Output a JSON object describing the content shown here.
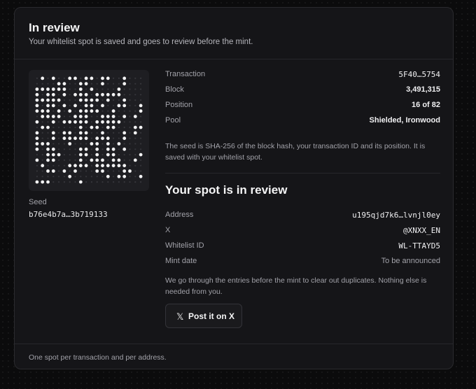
{
  "header": {
    "title": "In review",
    "subtitle": "Your whitelist spot is saved and goes to review before the mint."
  },
  "seed": {
    "label": "Seed",
    "value": "b76e4b7a…3b719133"
  },
  "details": [
    {
      "key": "Transaction",
      "value": "5F40…5754"
    },
    {
      "key": "Block",
      "value": "3,491,315"
    },
    {
      "key": "Position",
      "value": "16 of 82"
    },
    {
      "key": "Pool",
      "value": "Shielded, Ironwood"
    }
  ],
  "seed_note": "The seed is SHA-256 of the block hash, your transaction ID and its position. It is saved with your whitelist spot.",
  "review": {
    "title": "Your spot is in review",
    "rows": [
      {
        "key": "Address",
        "value": "u195qjd7k6…lvnjl0ey"
      },
      {
        "key": "X",
        "value": "@XNXX_EN"
      },
      {
        "key": "Whitelist ID",
        "value": "WL-TTAYD5"
      },
      {
        "key": "Mint date",
        "value": "To be announced"
      }
    ],
    "note": "We go through the entries before the mint to clear out duplicates. Nothing else is needed from you.",
    "button": {
      "icon": "x-logo-icon",
      "label": "Post it on X"
    }
  },
  "footer": "One spot per transaction and per address."
}
